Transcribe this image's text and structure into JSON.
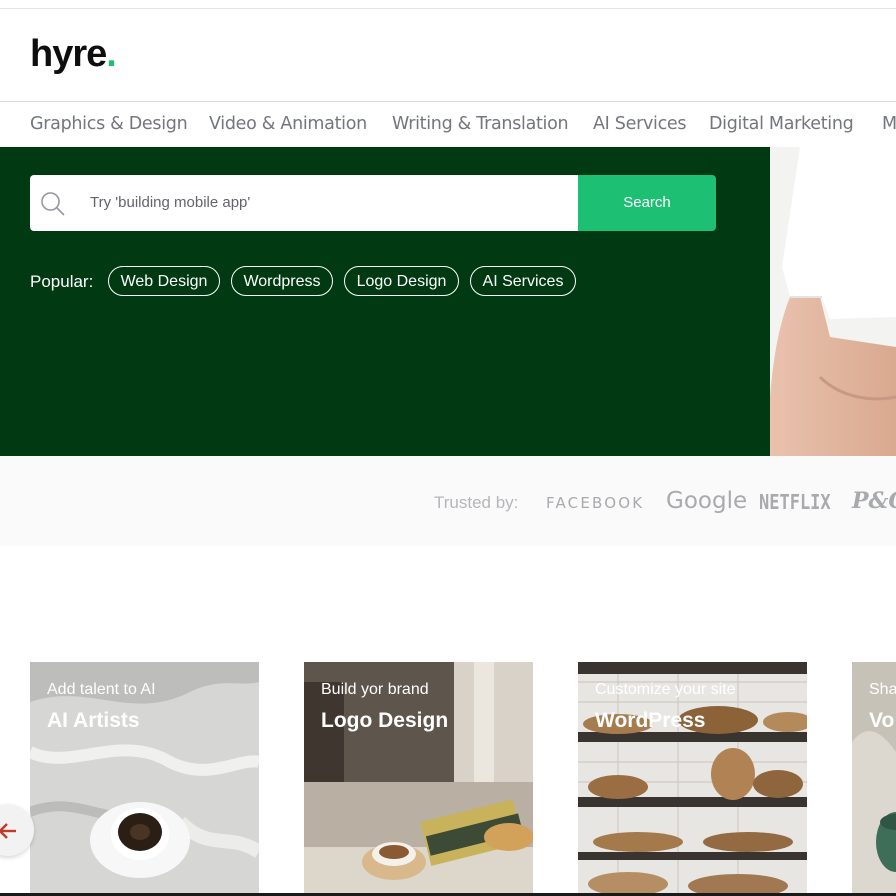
{
  "brand": {
    "name": "hyre",
    "dot": "."
  },
  "categories": [
    "Graphics & Design",
    "Video & Animation",
    "Writing & Translation",
    "AI Services",
    "Digital Marketing",
    "M"
  ],
  "search": {
    "placeholder": "Try 'building mobile app'",
    "button_label": "Search"
  },
  "popular": {
    "label": "Popular:",
    "tags": [
      "Web Design",
      "Wordpress",
      "Logo Design",
      "AI Services"
    ]
  },
  "trusted": {
    "label": "Trusted by:",
    "brands": [
      "FACEBOOK",
      "Google",
      "NETFLIX",
      "P&G"
    ]
  },
  "cards": [
    {
      "subtitle": "Add talent to AI",
      "title": "AI Artists"
    },
    {
      "subtitle": "Build yor brand",
      "title": "Logo Design"
    },
    {
      "subtitle": "Customize your site",
      "title": "WordPress"
    },
    {
      "subtitle": "Sha",
      "title": "Vo"
    }
  ],
  "colors": {
    "accent": "#1dbf73",
    "hero_bg": "#003912",
    "text_gray": "#74767e",
    "arrow": "#c0392b"
  },
  "icons": {
    "search": "search-icon",
    "prev": "arrow-left-icon"
  }
}
